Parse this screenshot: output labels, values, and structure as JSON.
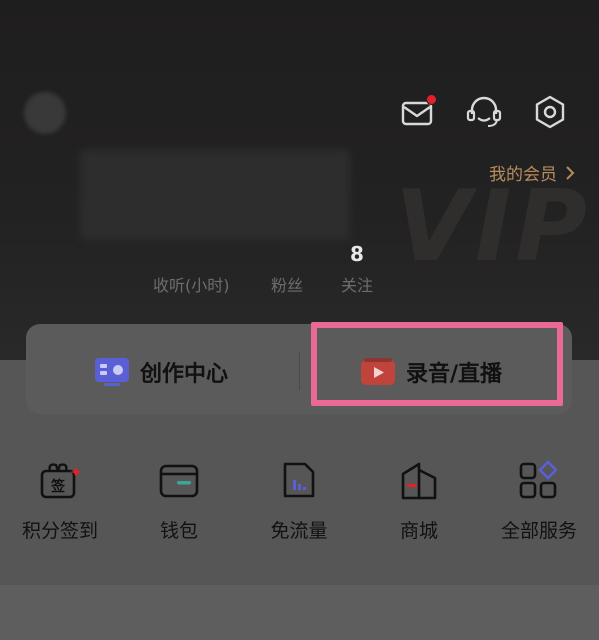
{
  "header": {
    "vip_link": "我的会员",
    "vip_watermark": "VIP",
    "stats": [
      {
        "value": "",
        "label": "收听(小时)"
      },
      {
        "value": "",
        "label": "粉丝"
      },
      {
        "value": "8",
        "label": "关注"
      }
    ],
    "icons": [
      "mail-icon",
      "support-icon",
      "settings-icon"
    ]
  },
  "card": {
    "create_label": "创作中心",
    "record_label": "录音/直播"
  },
  "services": [
    {
      "label": "积分签到",
      "icon": "checkin-gift-icon"
    },
    {
      "label": "钱包",
      "icon": "wallet-icon"
    },
    {
      "label": "免流量",
      "icon": "data-free-icon"
    },
    {
      "label": "商城",
      "icon": "mall-icon"
    },
    {
      "label": "全部服务",
      "icon": "all-services-icon"
    }
  ],
  "colors": {
    "accent_red": "#e4202b",
    "vip_gold": "#b88c5c",
    "highlight_pink": "#ea6a95",
    "create_purple": "#5b5fd6"
  }
}
